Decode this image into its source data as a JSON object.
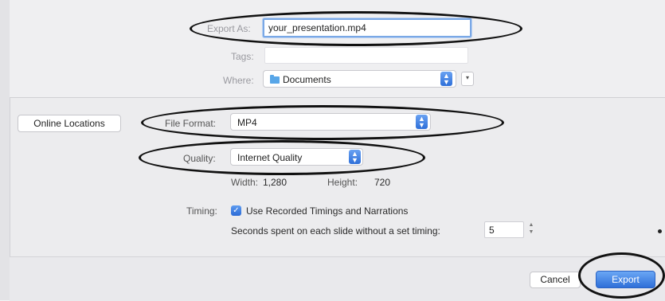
{
  "top": {
    "export_as_label": "Export As:",
    "export_as_value": "your_presentation.mp4",
    "tags_label": "Tags:",
    "tags_value": "",
    "where_label": "Where:",
    "where_value": "Documents"
  },
  "options": {
    "online_locations_label": "Online Locations",
    "file_format_label": "File Format:",
    "file_format_value": "MP4",
    "quality_label": "Quality:",
    "quality_value": "Internet Quality",
    "width_label": "Width:",
    "width_value": "1,280",
    "height_label": "Height:",
    "height_value": "720",
    "timing_label": "Timing:",
    "use_recorded_label": "Use Recorded Timings and Narrations",
    "use_recorded_checked": true,
    "seconds_label": "Seconds spent on each slide without a set timing:",
    "seconds_value": "5"
  },
  "footer": {
    "cancel_label": "Cancel",
    "export_label": "Export"
  },
  "icons": {
    "folder": "folder-icon",
    "stepper": "updown-arrows-icon",
    "checkbox": "checkmark-icon"
  },
  "colors": {
    "accent": "#2f6fd8",
    "annotation": "#111111"
  }
}
